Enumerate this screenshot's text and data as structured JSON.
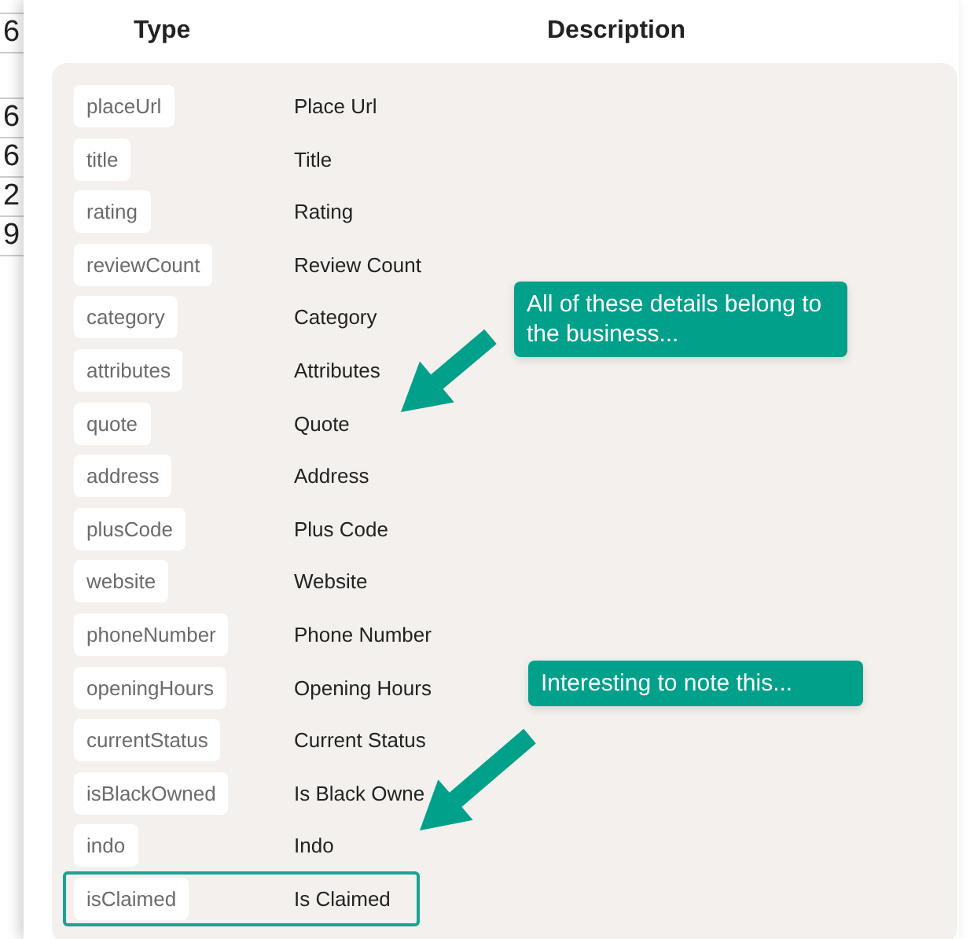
{
  "background_table": {
    "cells": [
      "6",
      "6",
      "6",
      "2",
      "9"
    ]
  },
  "dialog": {
    "columns": [
      "Type",
      "Description"
    ],
    "fields": [
      {
        "type": "placeUrl",
        "description": "Place Url",
        "highlighted": false
      },
      {
        "type": "title",
        "description": "Title",
        "highlighted": false
      },
      {
        "type": "rating",
        "description": "Rating",
        "highlighted": false
      },
      {
        "type": "reviewCount",
        "description": "Review Count",
        "highlighted": false
      },
      {
        "type": "category",
        "description": "Category",
        "highlighted": false
      },
      {
        "type": "attributes",
        "description": "Attributes",
        "highlighted": false
      },
      {
        "type": "quote",
        "description": "Quote",
        "highlighted": false
      },
      {
        "type": "address",
        "description": "Address",
        "highlighted": false
      },
      {
        "type": "plusCode",
        "description": "Plus Code",
        "highlighted": false
      },
      {
        "type": "website",
        "description": "Website",
        "highlighted": false
      },
      {
        "type": "phoneNumber",
        "description": "Phone Number",
        "highlighted": false
      },
      {
        "type": "openingHours",
        "description": "Opening Hours",
        "highlighted": false
      },
      {
        "type": "currentStatus",
        "description": "Current Status",
        "highlighted": false
      },
      {
        "type": "isBlackOwned",
        "description": "Is Black Owne",
        "highlighted": false
      },
      {
        "type": "indo",
        "description": "Indo",
        "highlighted": false
      },
      {
        "type": "isClaimed",
        "description": "Is Claimed",
        "highlighted": true
      }
    ]
  },
  "annotations": [
    {
      "text": "All of these details belong to the business..."
    },
    {
      "text": "Interesting to note this..."
    }
  ]
}
